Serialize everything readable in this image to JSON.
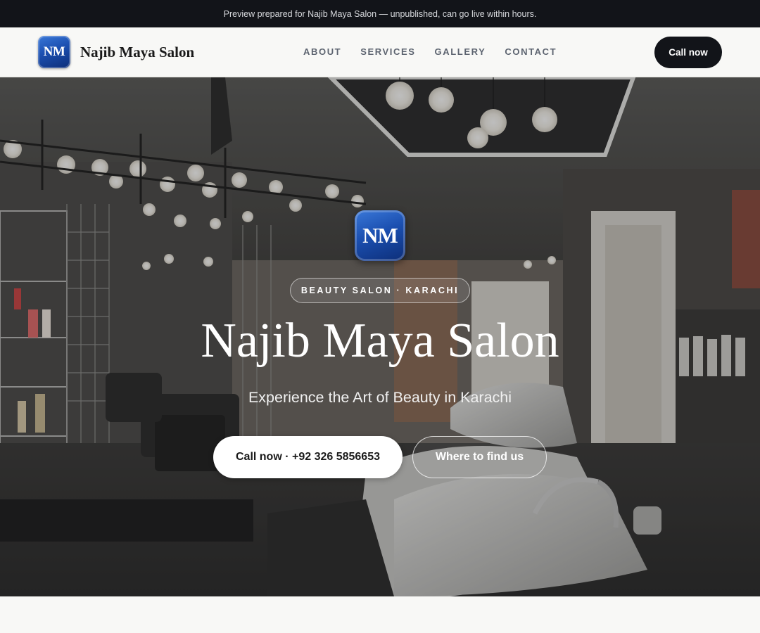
{
  "announcement": "Preview prepared for Najib Maya Salon — unpublished, can go live within hours.",
  "header": {
    "logo_text": "NM",
    "brand_name": "Najib Maya Salon",
    "nav": [
      "ABOUT",
      "SERVICES",
      "GALLERY",
      "CONTACT"
    ],
    "cta_label": "Call now"
  },
  "hero": {
    "logo_text": "NM",
    "tag": "BEAUTY SALON · KARACHI",
    "title": "Najib Maya Salon",
    "subtitle": "Experience the Art of Beauty in Karachi",
    "primary_button": "Call now · +92 326 5856653",
    "secondary_button": "Where to find us"
  },
  "colors": {
    "dark": "#121419",
    "logo_blue": "#1b4fb0",
    "nav_text": "#5d6470",
    "page_bg": "#f8f8f6"
  }
}
